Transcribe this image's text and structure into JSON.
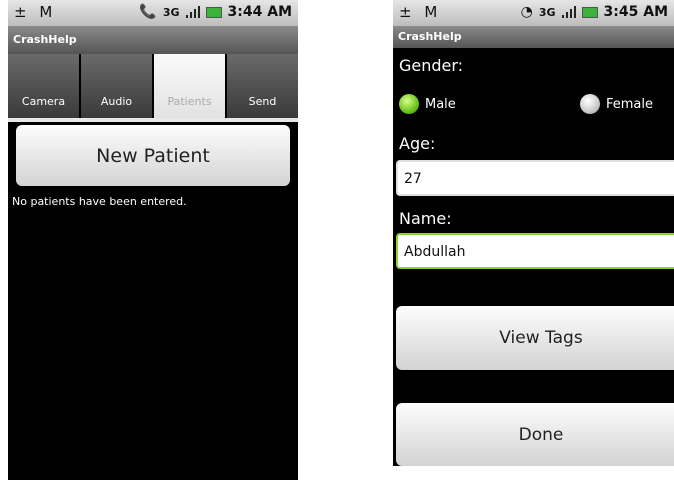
{
  "screen1": {
    "status": {
      "left_icons": "± M",
      "time": "3:44 AM",
      "network": "3G"
    },
    "app_title": "CrashHelp",
    "tabs": [
      {
        "label": "Camera"
      },
      {
        "label": "Audio"
      },
      {
        "label": "Patients",
        "selected": true
      },
      {
        "label": "Send"
      }
    ],
    "new_patient_label": "New Patient",
    "empty_message": "No patients have been entered."
  },
  "screen2": {
    "status": {
      "left_icons": "± M",
      "time": "3:45 AM",
      "network": "3G"
    },
    "app_title": "CrashHelp",
    "gender_label": "Gender:",
    "gender_options": [
      {
        "label": "Male",
        "checked": true
      },
      {
        "label": "Female",
        "checked": false
      }
    ],
    "age_label": "Age:",
    "age_value": "27",
    "name_label": "Name:",
    "name_value": "Abdullah",
    "view_tags_label": "View Tags",
    "done_label": "Done"
  },
  "colors": {
    "radio_selected": "#6cc21a",
    "focus_border": "#8bd22f"
  }
}
